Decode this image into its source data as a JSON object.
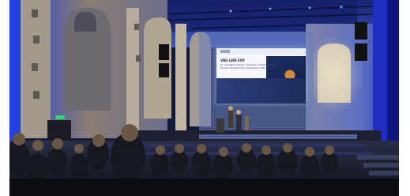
{
  "scene": {
    "description_colors": {
      "wall_blue": "#2d49c8",
      "stage_light": "#6f8fff",
      "audience_dark": "#141824"
    }
  },
  "slide": {
    "title": "VBG LVIR EXP",
    "subtitle": "Dr. Sebastian Mahler, Direktor, Präsident VBG\nAnne-K. Mustermann, Prävention VBG"
  }
}
